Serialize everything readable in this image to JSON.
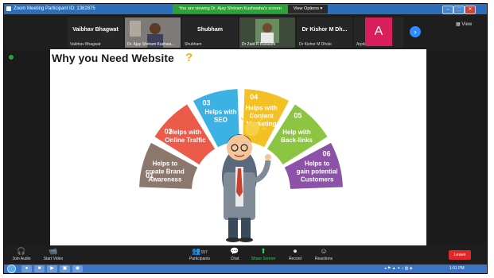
{
  "window": {
    "title": "Zoom Meeting Participant ID: 1382875",
    "banner": "You are viewing Dr. Ajay Shriram Kushwaha's screen",
    "view_options": "View Options ▾",
    "controls": [
      "–",
      "⬚",
      "✕"
    ]
  },
  "participants": [
    {
      "big_name": "Vaibhav Bhagwat",
      "small_name": "Vaibhav Bhagwat"
    },
    {
      "big_name": "",
      "small_name": "Dr. Ajay Shriram Kushwa..."
    },
    {
      "big_name": "Shubham",
      "small_name": "Shubham"
    },
    {
      "big_name": "",
      "small_name": "Dr Zaid R Balaadhi"
    },
    {
      "big_name": "Dr Kishor M Dh...",
      "small_name": "Dr Kishor M Dhole"
    },
    {
      "big_name": "A",
      "small_name": "Arpita Mitra"
    }
  ],
  "view_label": "View",
  "slide": {
    "title": "Why you Need Website",
    "question_mark": "?",
    "segments": [
      {
        "num": "01",
        "text": [
          "Helps to",
          "create Brand",
          "Awareness"
        ],
        "color": "#8b776b"
      },
      {
        "num": "02",
        "text": [
          "Helps with",
          "Online Traffic"
        ],
        "color": "#ec5b49"
      },
      {
        "num": "03",
        "text": [
          "Helps with",
          "SEO"
        ],
        "color": "#3cb1e4"
      },
      {
        "num": "04",
        "text": [
          "Helps with",
          "Content",
          "Marketing"
        ],
        "color": "#f4c124"
      },
      {
        "num": "05",
        "text": [
          "Help with",
          "Back-links"
        ],
        "color": "#8bc541"
      },
      {
        "num": "06",
        "text": [
          "Helps to",
          "gain potential",
          "Customers"
        ],
        "color": "#8b52a8"
      }
    ]
  },
  "controls": {
    "join_audio": "Join Audio",
    "start_video": "Start Video",
    "participants": "Participants",
    "participants_count": "157",
    "chat": "Chat",
    "share_screen": "Share Screen",
    "record": "Record",
    "reactions": "Reactions",
    "leave": "Leave"
  },
  "taskbar": {
    "clock": "1:01 PM"
  }
}
